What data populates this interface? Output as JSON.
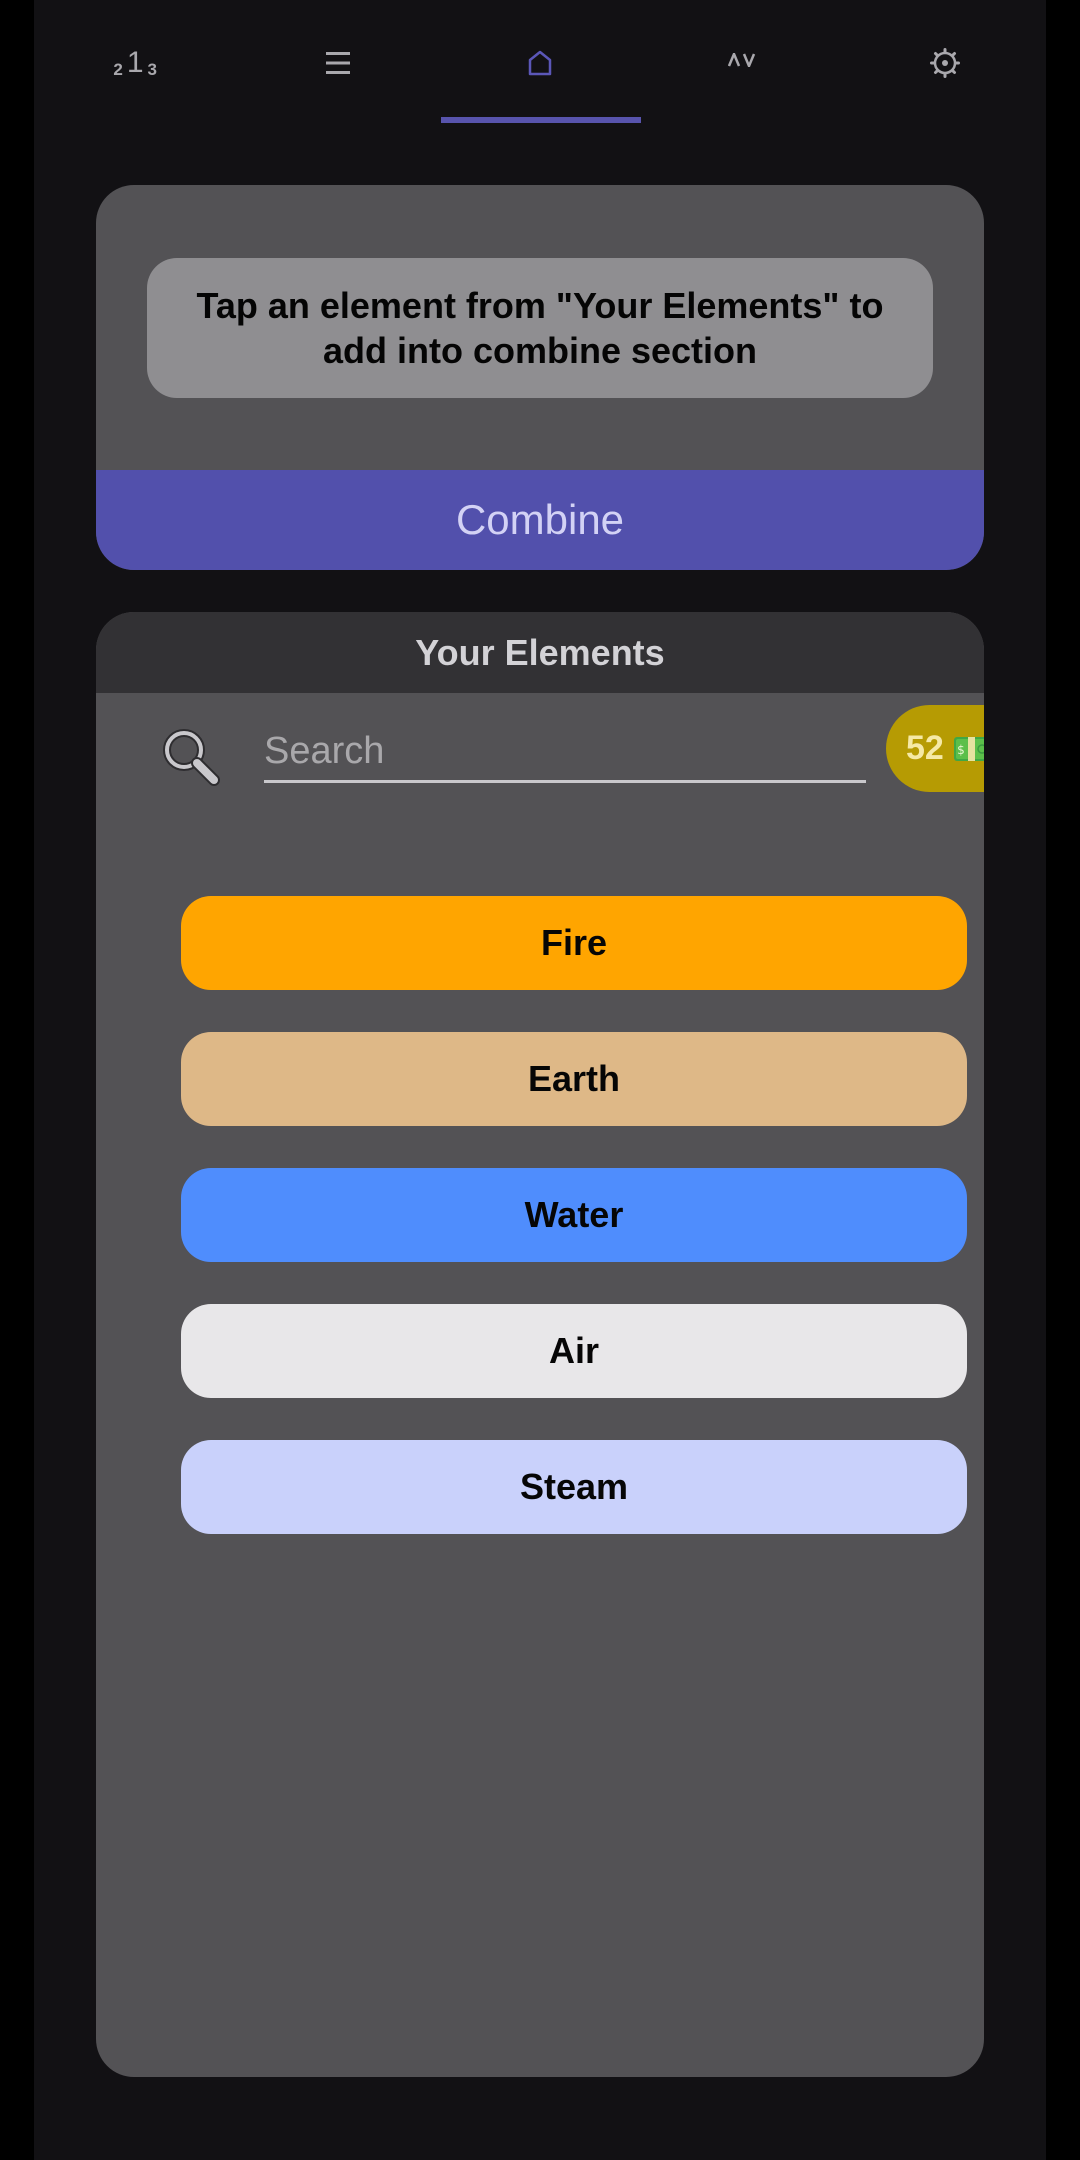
{
  "nav": {
    "tabs": [
      {
        "name": "leaderboard",
        "icon": "leaderboard-icon",
        "glyph": {
          "left": "2",
          "center": "1",
          "right": "3"
        },
        "active": false
      },
      {
        "name": "list",
        "icon": "menu-icon",
        "glyph": "☰",
        "active": false
      },
      {
        "name": "home",
        "icon": "home-icon",
        "glyph": "⌂",
        "active": true
      },
      {
        "name": "sort",
        "icon": "sort-icon",
        "glyph": "∧∨",
        "active": false
      },
      {
        "name": "settings",
        "icon": "gear-icon",
        "glyph": "⚙",
        "active": false
      }
    ],
    "accent_color": "#5854ad"
  },
  "combine": {
    "hint": "Tap an element from \"Your Elements\" to add into combine section",
    "button_label": "Combine"
  },
  "elements_panel": {
    "title": "Your Elements",
    "search": {
      "placeholder": "Search",
      "value": ""
    },
    "coins": {
      "count": "52",
      "icon": "money-icon"
    },
    "items": [
      {
        "label": "Fire",
        "color": "#ffa500"
      },
      {
        "label": "Earth",
        "color": "#deb887"
      },
      {
        "label": "Water",
        "color": "#4f8dfd"
      },
      {
        "label": "Air",
        "color": "#e8e7e9"
      },
      {
        "label": "Steam",
        "color": "#c9d1fb"
      }
    ]
  }
}
